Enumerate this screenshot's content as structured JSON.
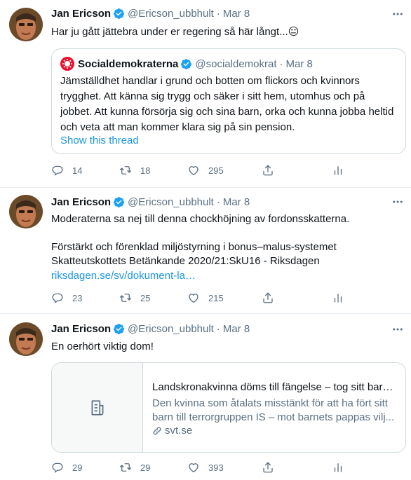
{
  "colors": {
    "accent": "#1da1f2",
    "text": "#0f1419",
    "secondary": "#5b7083",
    "border": "#e6ecf0"
  },
  "tweets": [
    {
      "author_name": "Jan Ericson",
      "handle": "@Ericson_ubbhult",
      "dot": "·",
      "date": "Mar 8",
      "text": "Har ju gått jättebra under er regering så här långt...😐",
      "quote": {
        "author_name": "Socialdemokraterna",
        "handle": "@socialdemokrat",
        "dot": "·",
        "date": "Mar 8",
        "text": "Jämställdhet handlar i grund och botten om flickors och kvinnors trygghet. Att känna sig trygg och säker i sitt hem, utomhus och på jobbet. Att kunna försörja sig och sina barn, orka och kunna jobba heltid och veta att man kommer klara sig på sin pension.",
        "show_thread": "Show this thread"
      },
      "replies": "14",
      "retweets": "18",
      "likes": "295"
    },
    {
      "author_name": "Jan Ericson",
      "handle": "@Ericson_ubbhult",
      "dot": "·",
      "date": "Mar 8",
      "text_line1": "Moderaterna sa nej till denna chockhöjning av fordonsskatterna.",
      "text_line2": "Förstärkt och förenklad miljöstyrning i bonus–malus-systemet",
      "text_line3": "Skatteutskottets Betänkande 2020/21:SkU16  - Riksdagen",
      "link": "riksdagen.se/sv/dokument-la…",
      "replies": "23",
      "retweets": "25",
      "likes": "215"
    },
    {
      "author_name": "Jan Ericson",
      "handle": "@Ericson_ubbhult",
      "dot": "·",
      "date": "Mar 8",
      "text": "En oerhört viktig dom!",
      "card": {
        "title": "Landskronakvinna döms till fängelse – tog sitt barn...",
        "description": "Den kvinna som åtalats misstänkt för att ha fört sitt barn till terrorgruppen IS – mot barnets pappas vilj...",
        "domain": "svt.se"
      },
      "replies": "29",
      "retweets": "29",
      "likes": "393"
    }
  ]
}
